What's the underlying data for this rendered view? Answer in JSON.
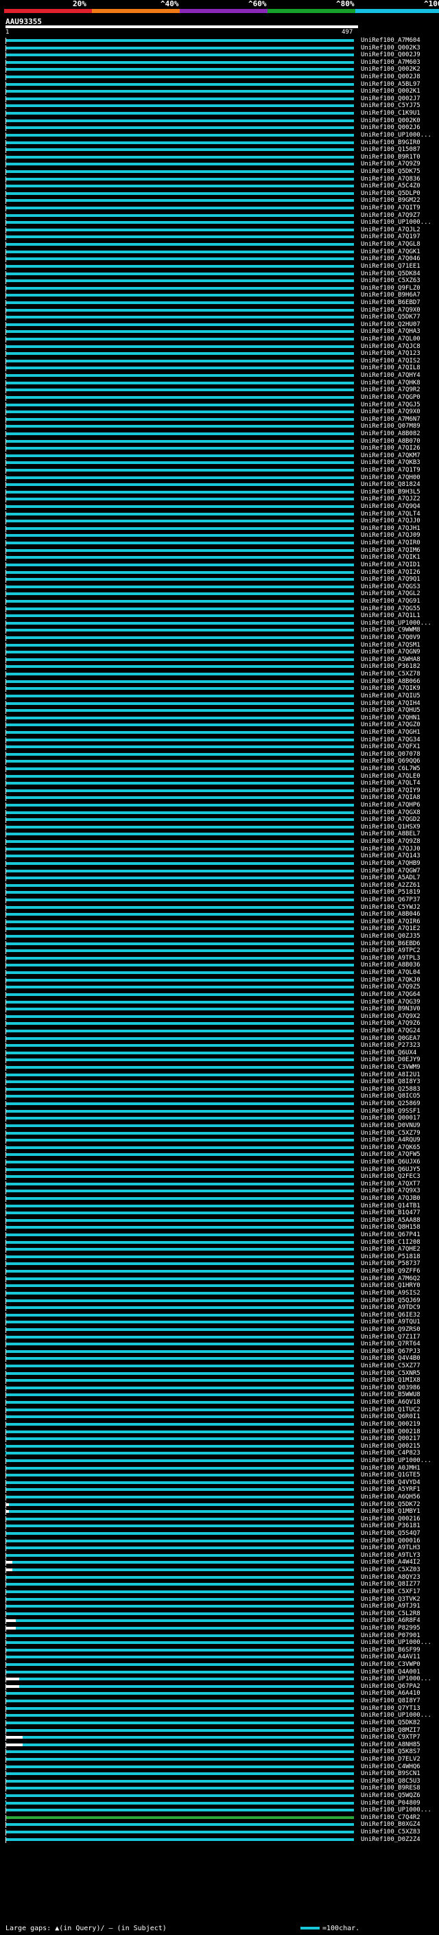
{
  "scale": {
    "labels": [
      "20%",
      "^40%",
      "^60%",
      "^80%",
      "^100%"
    ],
    "colors": [
      "#e0202c",
      "#f07a16",
      "#8a28b8",
      "#16a02c",
      "#16c0e0"
    ]
  },
  "query": {
    "name": "AAU93355",
    "start": "1",
    "end": "497"
  },
  "hits": [
    "UniRef100_A7M604",
    "UniRef100_Q002K3",
    "UniRef100_Q002J9",
    "UniRef100_A7M603",
    "UniRef100_Q002K2",
    "UniRef100_Q002J8",
    "UniRef100_A5BL97",
    "UniRef100_Q002K1",
    "UniRef100_Q002J7",
    "UniRef100_C5YJ75",
    "UniRef100_C1K9U1",
    "UniRef100_Q002K0",
    "UniRef100_Q002J6",
    "UniRef100_UP1000...",
    "UniRef100_B9GIR0",
    "UniRef100_Q15087",
    "UniRef100_B9R1T0",
    "UniRef100_A7Q9Z9",
    "UniRef100_Q5DK75",
    "UniRef100_A7Q836",
    "UniRef100_A5C4Z0",
    "UniRef100_Q5DLP0",
    "UniRef100_B9GM22",
    "UniRef100_A7QIT9",
    "UniRef100_A7Q9Z7",
    "UniRef100_UP1000...",
    "UniRef100_A7QJL2",
    "UniRef100_A7Q197",
    "UniRef100_A7QGL8",
    "UniRef100_A7QGK1",
    "UniRef100_A7Q046",
    "UniRef100_Q71EE1",
    "UniRef100_Q5DK84",
    "UniRef100_C5XZ63",
    "UniRef100_Q9FLZ0",
    "UniRef100_B9H6A7",
    "UniRef100_B6EBD7",
    "UniRef100_A7Q9X0",
    "UniRef100_Q5DK77",
    "UniRef100_Q2HU07",
    "UniRef100_A7QHA3",
    "UniRef100_A7QL00",
    "UniRef100_A7QJC8",
    "UniRef100_A7Q123",
    "UniRef100_A7QIS2",
    "UniRef100_A7QIL8",
    "UniRef100_A7QHY4",
    "UniRef100_A7QHK8",
    "UniRef100_A7Q9R2",
    "UniRef100_A7QGP0",
    "UniRef100_A7QGJ5",
    "UniRef100_A7Q9X0",
    "UniRef100_A7M6N7",
    "UniRef100_Q07M89",
    "UniRef100_A8B082",
    "UniRef100_A8B070",
    "UniRef100_A7QI26",
    "UniRef100_A7QKM7",
    "UniRef100_A7QKB3",
    "UniRef100_A7Q1T9",
    "UniRef100_A7QH00",
    "UniRef100_Q81824",
    "UniRef100_B9H3L5",
    "UniRef100_A7QJZ2",
    "UniRef100_A7Q9Q4",
    "UniRef100_A7QLT4",
    "UniRef100_A7QJJ0",
    "UniRef100_A7QJH1",
    "UniRef100_A7QJ09",
    "UniRef100_A7QIR0",
    "UniRef100_A7QIM6",
    "UniRef100_A7QIK1",
    "UniRef100_A7QID1",
    "UniRef100_A7QI26",
    "UniRef100_A7Q9Q1",
    "UniRef100_A7QGS3",
    "UniRef100_A7QGL2",
    "UniRef100_A7QG91",
    "UniRef100_A7QG55",
    "UniRef100_A7Q1L1",
    "UniRef100_UP1000...",
    "UniRef100_C9WWM8",
    "UniRef100_A7Q0V9",
    "UniRef100_A7QSM1",
    "UniRef100_A7QGN9",
    "UniRef100_A5WHA8",
    "UniRef100_P36182",
    "UniRef100_C5XZ78",
    "UniRef100_A8B066",
    "UniRef100_A7QIK9",
    "UniRef100_A7QIU5",
    "UniRef100_A7QIH4",
    "UniRef100_A7QHU5",
    "UniRef100_A7QHN1",
    "UniRef100_A7QGZ0",
    "UniRef100_A7QGH1",
    "UniRef100_A7QG34",
    "UniRef100_A7QFX1",
    "UniRef100_Q07078",
    "UniRef100_Q69QQ6",
    "UniRef100_C6L7W5",
    "UniRef100_A7QLE0",
    "UniRef100_A7QLT4",
    "UniRef100_A7QIY9",
    "UniRef100_A7QIA8",
    "UniRef100_A7QHP6",
    "UniRef100_A7QGX8",
    "UniRef100_A7QGD2",
    "UniRef100_Q1HSX9",
    "UniRef100_A8BEL7",
    "UniRef100_A7Q9Z8",
    "UniRef100_A7QJJ0",
    "UniRef100_A7Q143",
    "UniRef100_A7QHB9",
    "UniRef100_A7QGW7",
    "UniRef100_A5ADL7",
    "UniRef100_A2ZZ61",
    "UniRef100_P51819",
    "UniRef100_Q67P37",
    "UniRef100_C5YWJ2",
    "UniRef100_A8B046",
    "UniRef100_A7QIR6",
    "UniRef100_A7Q1E2",
    "UniRef100_Q0ZJ35",
    "UniRef100_B6EBD6",
    "UniRef100_A9TPC2",
    "UniRef100_A9TPL3",
    "UniRef100_A8B036",
    "UniRef100_A7QL04",
    "UniRef100_A7QKJ0",
    "UniRef100_A7Q9Z5",
    "UniRef100_A7QG64",
    "UniRef100_A7QG39",
    "UniRef100_B9N3V0",
    "UniRef100_A7Q9X2",
    "UniRef100_A7Q9Z6",
    "UniRef100_A7QG24",
    "UniRef100_Q0GEA7",
    "UniRef100_P27323",
    "UniRef100_Q6UX4",
    "UniRef100_D0EJY9",
    "UniRef100_C3VWM9",
    "UniRef100_A8I2U1",
    "UniRef100_Q8I8Y3",
    "UniRef100_Q25883",
    "UniRef100_Q8ICO5",
    "UniRef100_Q25869",
    "UniRef100_Q9SSF1",
    "UniRef100_Q00017",
    "UniRef100_D0VNU9",
    "UniRef100_C5XZ79",
    "UniRef100_A4RQU9",
    "UniRef100_A7QK65",
    "UniRef100_A7QFW5",
    "UniRef100_Q6UJX6",
    "UniRef100_Q6UJY5",
    "UniRef100_Q2FEC3",
    "UniRef100_A7QXT7",
    "UniRef100_A7Q9X3",
    "UniRef100_A7QJB0",
    "UniRef100_Q14TB1",
    "UniRef100_B1Q477",
    "UniRef100_A5AA88",
    "UniRef100_Q8H158",
    "UniRef100_Q67P41",
    "UniRef100_C1I208",
    "UniRef100_A7QHE2",
    "UniRef100_P51818",
    "UniRef100_P58737",
    "UniRef100_Q9ZFF6",
    "UniRef100_A7M6Q2",
    "UniRef100_Q1HRY0",
    "UniRef100_A9SIS2",
    "UniRef100_Q5QJ69",
    "UniRef100_A9TDC9",
    "UniRef100_Q6IE32",
    "UniRef100_A9TQU1",
    "UniRef100_Q9ZRS0",
    "UniRef100_Q7Z1I7",
    "UniRef100_Q7RT64",
    "UniRef100_Q67PJ3",
    "UniRef100_Q4V4B0",
    "UniRef100_C5XZ77",
    "UniRef100_C5XNR5",
    "UniRef100_Q1MIX8",
    "UniRef100_Q03986",
    "UniRef100_B5WWU8",
    "UniRef100_A6QV18",
    "UniRef100_Q1TUC2",
    "UniRef100_Q6R0I1",
    "UniRef100_Q00219",
    "UniRef100_Q00218",
    "UniRef100_Q00217",
    "UniRef100_Q00215",
    "UniRef100_C4P823",
    "UniRef100_UP1000...",
    "UniRef100_A0JMH1",
    "UniRef100_Q1GTE5",
    "UniRef100_Q4VYD4",
    "UniRef100_A5YRF1",
    "UniRef100_A6QH56",
    "UniRef100_Q5DK72",
    "UniRef100_Q1MBY1",
    "UniRef100_Q00216",
    "UniRef100_P36181",
    "UniRef100_Q5S4Q7",
    "UniRef100_Q00016",
    "UniRef100_A9TLH3",
    "UniRef100_A9TLY3",
    "UniRef100_A4W4I2",
    "UniRef100_C5XZ03",
    "UniRef100_A8QY23",
    "UniRef100_Q8IZ77",
    "UniRef100_C5XF17",
    "UniRef100_Q3TVK2",
    "UniRef100_A9TJ91",
    "UniRef100_C5L2R8",
    "UniRef100_A6R8F4",
    "UniRef100_P82995",
    "UniRef100_P07901",
    "UniRef100_UP1000...",
    "UniRef100_B6SF99",
    "UniRef100_A4AV11",
    "UniRef100_C3VWP0",
    "UniRef100_Q4A001",
    "UniRef100_UP1000...",
    "UniRef100_Q67PA2",
    "UniRef100_A6A410",
    "UniRef100_Q8I8Y7",
    "UniRef100_Q7YT13",
    "UniRef100_UP1000...",
    "UniRef100_Q5DK82",
    "UniRef100_Q8MZI7",
    "UniRef100_C9XTP7",
    "UniRef100_A8NH85",
    "UniRef100_Q5K8S7",
    "UniRef100_D7ELV2",
    "UniRef100_C4WHQ6",
    "UniRef100_B9SCN1",
    "UniRef100_Q8C5U3",
    "UniRef100_B9RES8",
    "UniRef100_Q5WQZ6",
    "UniRef100_P04809",
    "UniRef100_UP1000...",
    "UniRef100_C7Q4R2",
    "UniRef100_B0XGZ4",
    "UniRef100_C5XZ83",
    "UniRef100_D0Z2Z4"
  ],
  "footer": {
    "gaps_legend": "Large gaps: ▲(in Query)/ — (in Subject)",
    "char_legend": "=100char."
  }
}
